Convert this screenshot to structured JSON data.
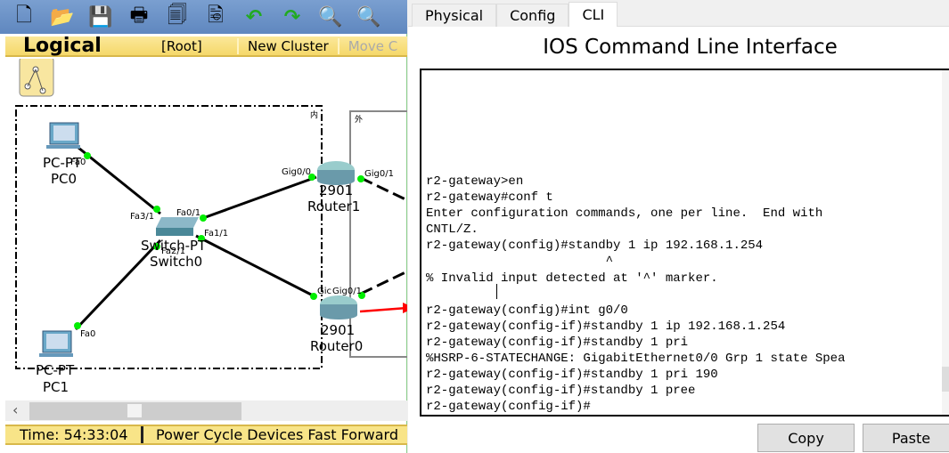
{
  "toolbar": {
    "icons": [
      "new-file-icon",
      "open-folder-icon",
      "save-icon",
      "print-icon",
      "copy-icon",
      "paste-icon",
      "undo-icon",
      "redo-icon",
      "zoom-in-icon",
      "zoom-reset-icon"
    ]
  },
  "logical_bar": {
    "title": "Logical",
    "root": "[Root]",
    "new_cluster": "New Cluster",
    "move": "Move C"
  },
  "topology": {
    "cluster_inner": "内",
    "cluster_outer": "外",
    "devices": [
      {
        "model": "PC-PT",
        "name": "PC0"
      },
      {
        "model": "PC-PT",
        "name": "PC1"
      },
      {
        "model": "Switch-PT",
        "name": "Switch0"
      },
      {
        "model": "2901",
        "name": "Router1"
      },
      {
        "model": "2901",
        "name": "Router0"
      }
    ],
    "ports": {
      "pc0": "Fa0",
      "pc1": "Fa0",
      "sw_fa31": "Fa3/1",
      "sw_fa01": "Fa0/1",
      "sw_fa11": "Fa1/1",
      "sw_fa21": "Fa2/1",
      "r1_g00": "Gig0/0",
      "r1_g01": "Gig0/1",
      "r0_g00": "Gic",
      "r0_g01": "Gig0/1"
    },
    "link_color": "#00e000"
  },
  "status": {
    "time": "Time: 54:33:04",
    "rest": "Power Cycle Devices  Fast Forward"
  },
  "tabs": [
    "Physical",
    "Config",
    "CLI"
  ],
  "active_tab": "CLI",
  "cli": {
    "title": "IOS Command Line Interface",
    "output": "r2-gateway>en\nr2-gateway#conf t\nEnter configuration commands, one per line.  End with\nCNTL/Z.\nr2-gateway(config)#standby 1 ip 192.168.1.254\n                        ^\n% Invalid input detected at '^' marker.\n\nr2-gateway(config)#int g0/0\nr2-gateway(config-if)#standby 1 ip 192.168.1.254\nr2-gateway(config-if)#standby 1 pri\n%HSRP-6-STATECHANGE: GigabitEthernet0/0 Grp 1 state Spea\nr2-gateway(config-if)#standby 1 pri 190\nr2-gateway(config-if)#standby 1 pree\nr2-gateway(config-if)#",
    "copy": "Copy",
    "paste": "Paste"
  }
}
